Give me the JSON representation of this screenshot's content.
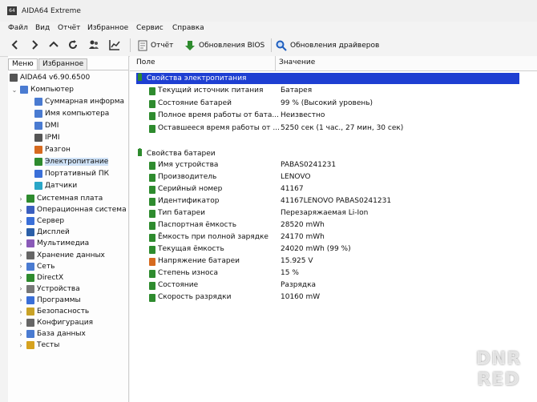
{
  "app": {
    "title": "AIDA64 Extreme",
    "icon_text": "64"
  },
  "menu": [
    "Файл",
    "Вид",
    "Отчёт",
    "Избранное",
    "Сервис",
    "Справка"
  ],
  "toolbar": {
    "report_label": "Отчёт",
    "bios_label": "Обновления BIOS",
    "drivers_label": "Обновления драйверов"
  },
  "tabs": {
    "menu": "Меню",
    "favorites": "Избранное"
  },
  "tree": {
    "root": "AIDA64 v6.90.6500",
    "computer": "Компьютер",
    "computer_children": [
      "Суммарная информа",
      "Имя компьютера",
      "DMI",
      "IPMI",
      "Разгон",
      "Электропитание",
      "Портативный ПК",
      "Датчики"
    ],
    "others": [
      "Системная плата",
      "Операционная система",
      "Сервер",
      "Дисплей",
      "Мультимедиа",
      "Хранение данных",
      "Сеть",
      "DirectX",
      "Устройства",
      "Программы",
      "Безопасность",
      "Конфигурация",
      "База данных",
      "Тесты"
    ]
  },
  "columns": {
    "field": "Поле",
    "value": "Значение"
  },
  "power": {
    "title": "Свойства электропитания",
    "rows": [
      {
        "field": "Текущий источник питания",
        "value": "Батарея"
      },
      {
        "field": "Состояние батарей",
        "value": "99 % (Высокий уровень)"
      },
      {
        "field": "Полное время работы от бата...",
        "value": "Неизвестно"
      },
      {
        "field": "Оставшееся время работы от ...",
        "value": "5250 сек (1 час., 27 мин, 30 сек)"
      }
    ]
  },
  "battery": {
    "title": "Свойства батареи",
    "rows": [
      {
        "field": "Имя устройства",
        "value": "PABAS0241231"
      },
      {
        "field": "Производитель",
        "value": "LENOVO"
      },
      {
        "field": "Серийный номер",
        "value": "41167"
      },
      {
        "field": "Идентификатор",
        "value": "41167LENOVO PABAS0241231"
      },
      {
        "field": "Тип батареи",
        "value": "Перезаряжаемая Li-Ion"
      },
      {
        "field": "Паспортная ёмкость",
        "value": "28520 mWh"
      },
      {
        "field": "Ёмкость при полной зарядке",
        "value": "24170 mWh"
      },
      {
        "field": "Текущая ёмкость",
        "value": "24020 mWh  (99 %)"
      },
      {
        "field": "Напряжение батареи",
        "value": "15.925 V"
      },
      {
        "field": "Степень износа",
        "value": "15 %"
      },
      {
        "field": "Состояние",
        "value": "Разрядка"
      },
      {
        "field": "Скорость разрядки",
        "value": "10160 mW"
      }
    ]
  },
  "watermark": {
    "line1": "DNR",
    "line2": "RED"
  },
  "colors": {
    "selection": "#1e3fd2",
    "battery_icon": "#2e8b2e",
    "accent": "#3a6fd8"
  }
}
